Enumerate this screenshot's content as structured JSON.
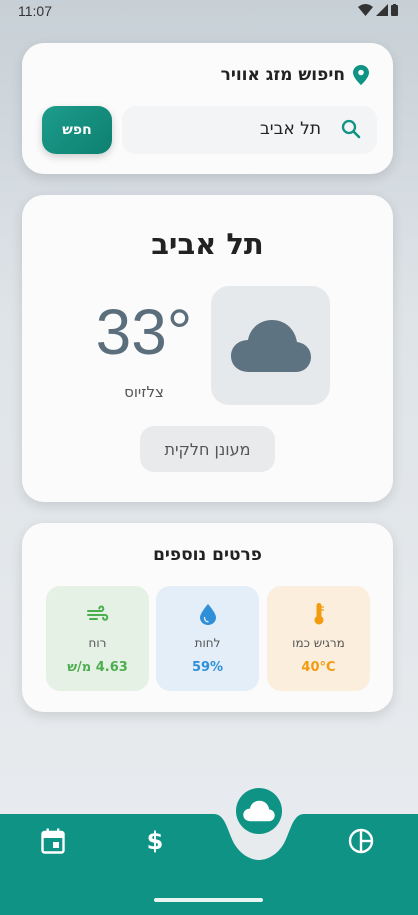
{
  "status_bar": {
    "time": "11:07"
  },
  "search_card": {
    "title": "חיפוש מזג אוויר",
    "search_value": "תל אביב",
    "search_button": "חפש"
  },
  "weather": {
    "city": "תל אביב",
    "temperature": "33°",
    "unit": "צלזיוס",
    "condition": "מעונן חלקית",
    "icon": "cloud-icon"
  },
  "details": {
    "title": "פרטים נוספים",
    "feels_like": {
      "label": "מרגיש כמו",
      "value": "40°C",
      "icon": "thermometer-icon"
    },
    "humidity": {
      "label": "לחות",
      "value": "59%",
      "icon": "water-drop-icon"
    },
    "wind": {
      "label": "רוח",
      "value": "4.63 מ/ש",
      "icon": "wind-icon"
    }
  },
  "bottom_nav": {
    "items": [
      "calendar-icon",
      "dollar-icon",
      "cloud-icon",
      "pie-chart-icon"
    ],
    "active": "cloud-icon"
  },
  "colors": {
    "primary": "#0e9384",
    "feels_like": "#f29b11",
    "humidity": "#2f8fd8",
    "wind": "#4cae4f"
  }
}
